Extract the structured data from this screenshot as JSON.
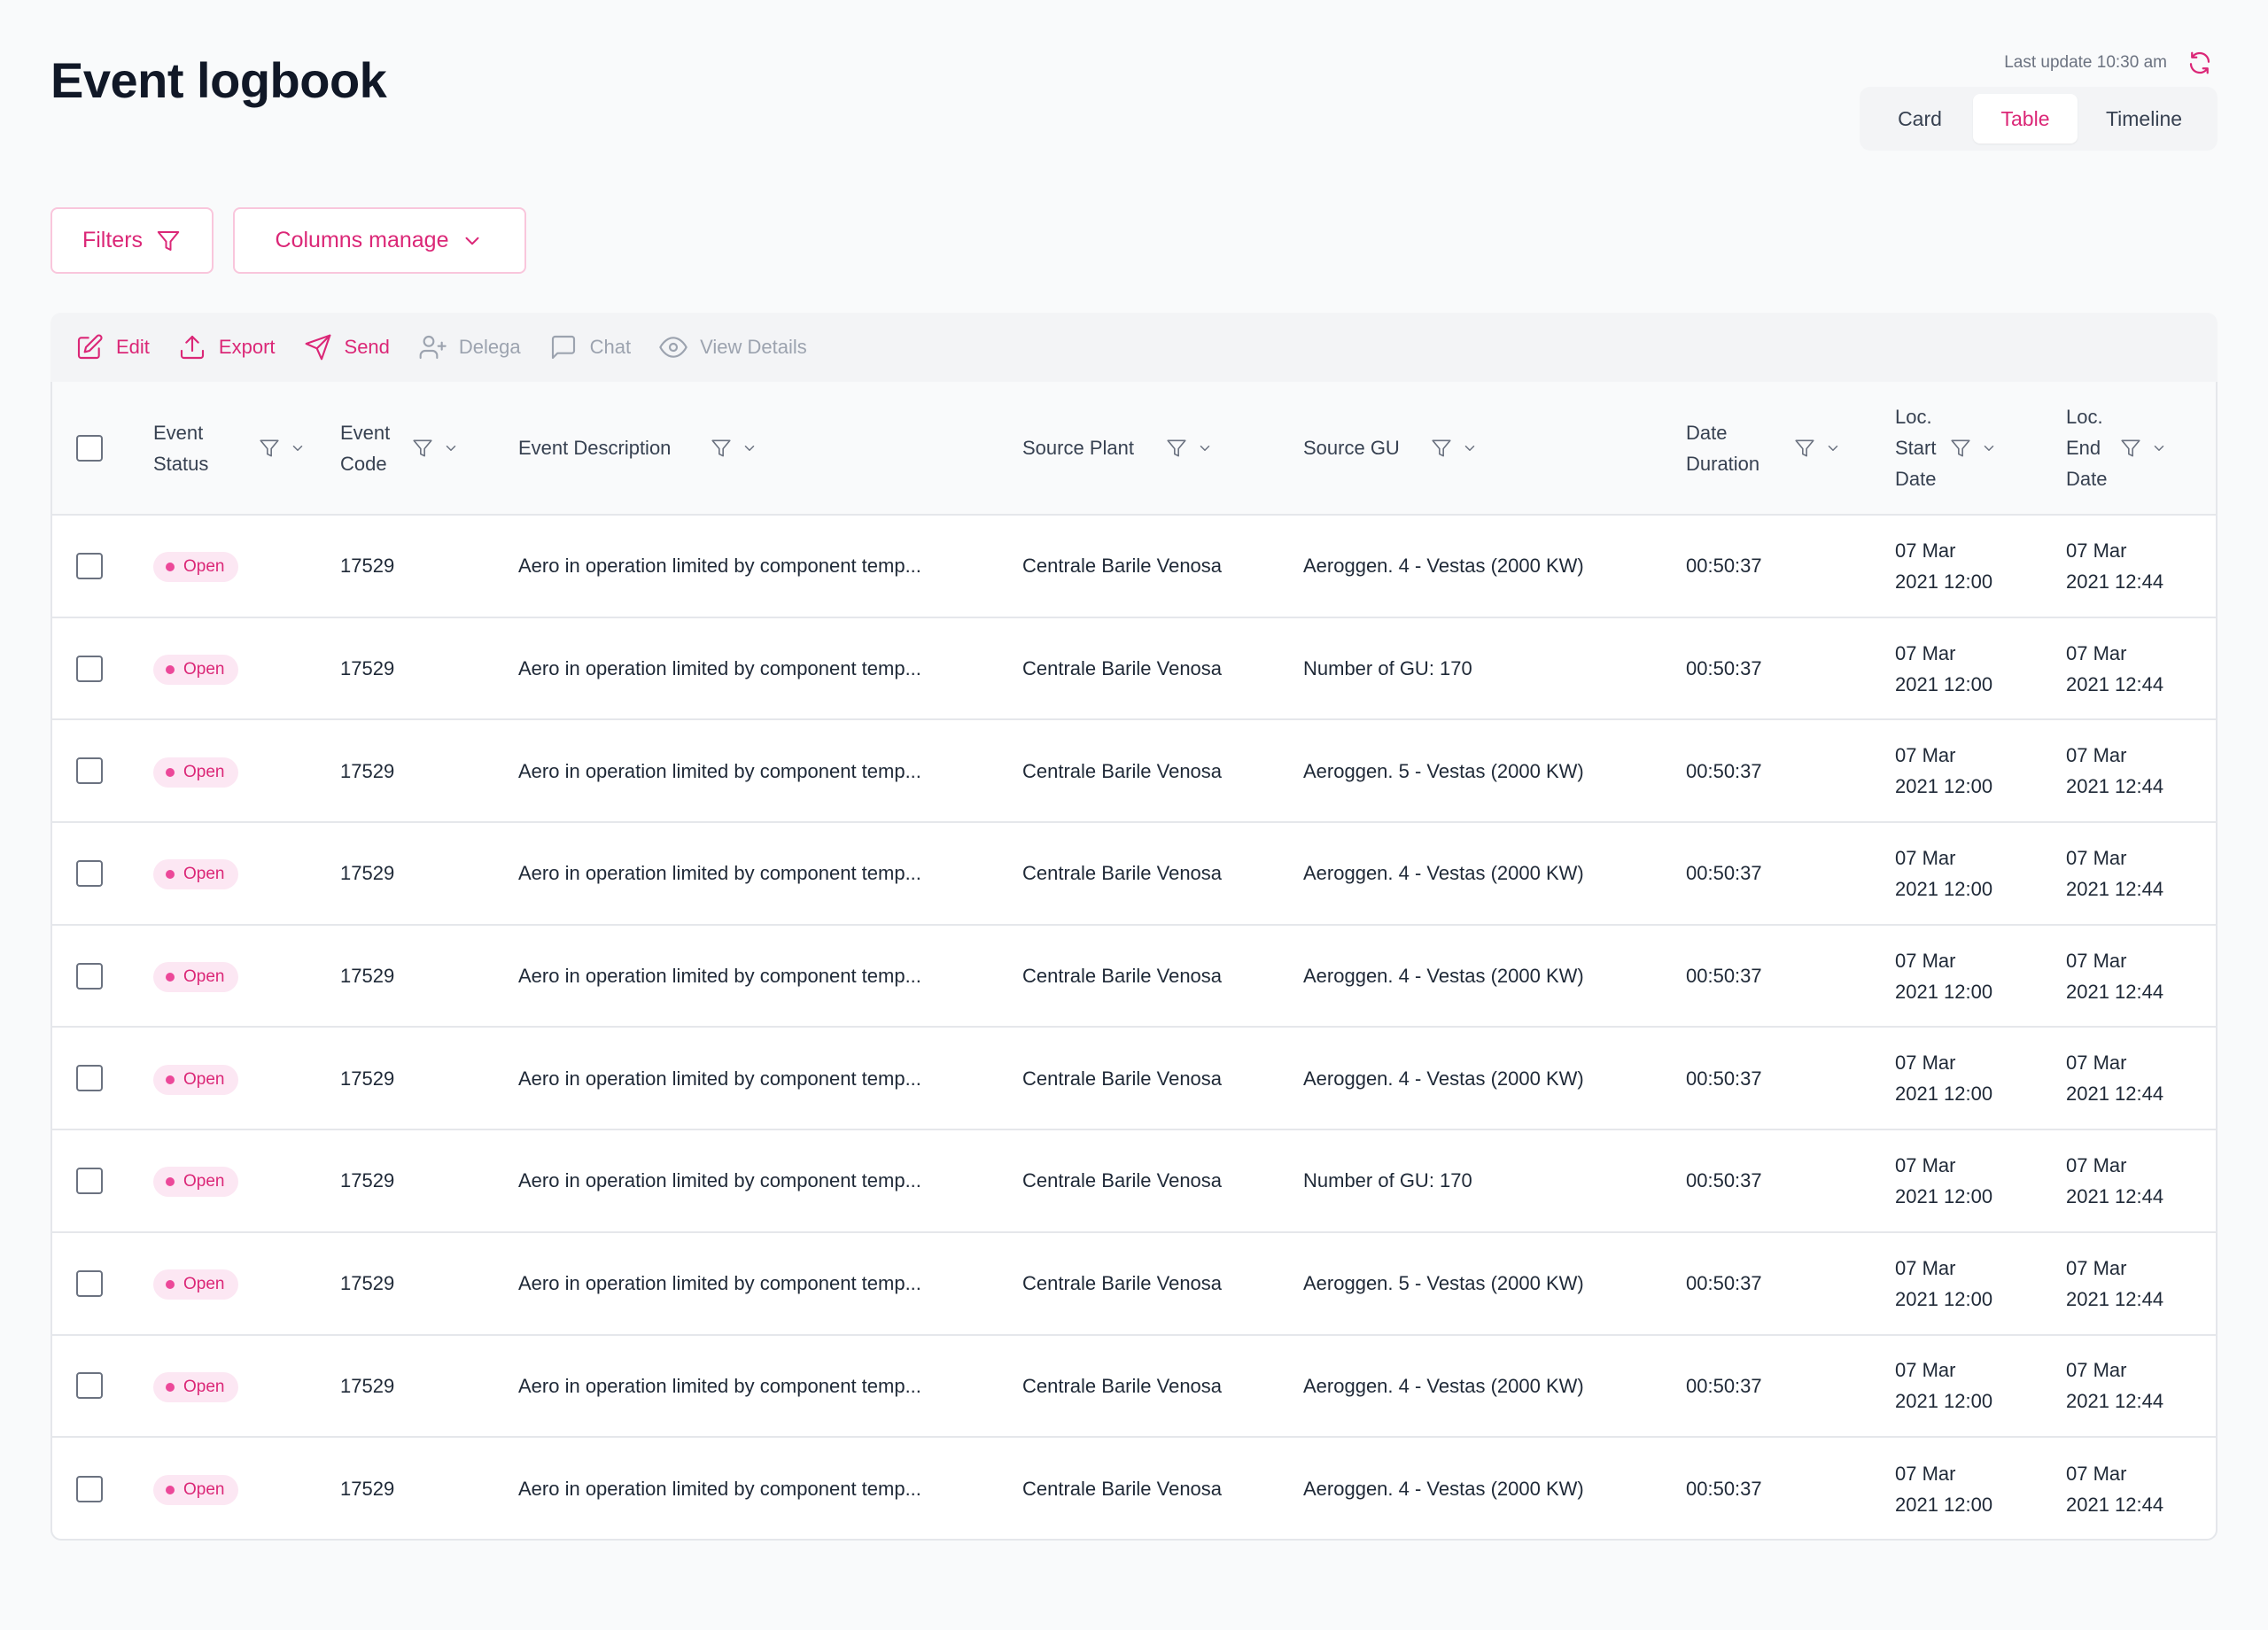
{
  "page": {
    "title": "Event logbook"
  },
  "header": {
    "last_update": "Last update 10:30 am",
    "views": [
      {
        "label": "Card",
        "active": false
      },
      {
        "label": "Table",
        "active": true
      },
      {
        "label": "Timeline",
        "active": false
      }
    ]
  },
  "controls": {
    "filters_label": "Filters",
    "columns_label": "Columns manage"
  },
  "toolbar": {
    "items": [
      {
        "label": "Edit",
        "icon": "edit-icon",
        "enabled": true
      },
      {
        "label": "Export",
        "icon": "upload-icon",
        "enabled": true
      },
      {
        "label": "Send",
        "icon": "send-icon",
        "enabled": true
      },
      {
        "label": "Delega",
        "icon": "user-plus-icon",
        "enabled": false
      },
      {
        "label": "Chat",
        "icon": "chat-icon",
        "enabled": false
      },
      {
        "label": "View Details",
        "icon": "eye-icon",
        "enabled": false
      }
    ]
  },
  "table": {
    "columns": [
      {
        "key": "status",
        "lines": [
          "Event",
          "Status"
        ]
      },
      {
        "key": "code",
        "lines": [
          "Event",
          "Code"
        ]
      },
      {
        "key": "description",
        "lines": [
          "Event Description"
        ]
      },
      {
        "key": "plant",
        "lines": [
          "Source Plant"
        ]
      },
      {
        "key": "gu",
        "lines": [
          "Source GU"
        ]
      },
      {
        "key": "duration",
        "lines": [
          "Date",
          "Duration"
        ]
      },
      {
        "key": "start",
        "lines": [
          "Loc.",
          "Start",
          "Date"
        ]
      },
      {
        "key": "end",
        "lines": [
          "Loc.",
          "End",
          "Date"
        ]
      }
    ],
    "rows": [
      {
        "status": "Open",
        "code": "17529",
        "description": "Aero in operation limited by component temp...",
        "plant": "Centrale Barile Venosa",
        "gu": "Aeroggen. 4 - Vestas (2000 KW)",
        "duration": "00:50:37",
        "start": [
          "07 Mar",
          "2021 12:00"
        ],
        "end": [
          "07 Mar",
          "2021 12:44"
        ]
      },
      {
        "status": "Open",
        "code": "17529",
        "description": "Aero in operation limited by component temp...",
        "plant": "Centrale Barile Venosa",
        "gu": "Number of GU: 170",
        "duration": "00:50:37",
        "start": [
          "07 Mar",
          "2021 12:00"
        ],
        "end": [
          "07 Mar",
          "2021 12:44"
        ]
      },
      {
        "status": "Open",
        "code": "17529",
        "description": "Aero in operation limited by component temp...",
        "plant": "Centrale Barile Venosa",
        "gu": "Aeroggen. 5 - Vestas (2000 KW)",
        "duration": "00:50:37",
        "start": [
          "07 Mar",
          "2021 12:00"
        ],
        "end": [
          "07 Mar",
          "2021 12:44"
        ]
      },
      {
        "status": "Open",
        "code": "17529",
        "description": "Aero in operation limited by component temp...",
        "plant": "Centrale Barile Venosa",
        "gu": "Aeroggen. 4 - Vestas (2000 KW)",
        "duration": "00:50:37",
        "start": [
          "07 Mar",
          "2021 12:00"
        ],
        "end": [
          "07 Mar",
          "2021 12:44"
        ]
      },
      {
        "status": "Open",
        "code": "17529",
        "description": "Aero in operation limited by component temp...",
        "plant": "Centrale Barile Venosa",
        "gu": "Aeroggen. 4 - Vestas (2000 KW)",
        "duration": "00:50:37",
        "start": [
          "07 Mar",
          "2021 12:00"
        ],
        "end": [
          "07 Mar",
          "2021 12:44"
        ]
      },
      {
        "status": "Open",
        "code": "17529",
        "description": "Aero in operation limited by component temp...",
        "plant": "Centrale Barile Venosa",
        "gu": "Aeroggen. 4 - Vestas (2000 KW)",
        "duration": "00:50:37",
        "start": [
          "07 Mar",
          "2021 12:00"
        ],
        "end": [
          "07 Mar",
          "2021 12:44"
        ]
      },
      {
        "status": "Open",
        "code": "17529",
        "description": "Aero in operation limited by component temp...",
        "plant": "Centrale Barile Venosa",
        "gu": "Number of GU: 170",
        "duration": "00:50:37",
        "start": [
          "07 Mar",
          "2021 12:00"
        ],
        "end": [
          "07 Mar",
          "2021 12:44"
        ]
      },
      {
        "status": "Open",
        "code": "17529",
        "description": "Aero in operation limited by component temp...",
        "plant": "Centrale Barile Venosa",
        "gu": "Aeroggen. 5 - Vestas (2000 KW)",
        "duration": "00:50:37",
        "start": [
          "07 Mar",
          "2021 12:00"
        ],
        "end": [
          "07 Mar",
          "2021 12:44"
        ]
      },
      {
        "status": "Open",
        "code": "17529",
        "description": "Aero in operation limited by component temp...",
        "plant": "Centrale Barile Venosa",
        "gu": "Aeroggen. 4 - Vestas (2000 KW)",
        "duration": "00:50:37",
        "start": [
          "07 Mar",
          "2021 12:00"
        ],
        "end": [
          "07 Mar",
          "2021 12:44"
        ]
      },
      {
        "status": "Open",
        "code": "17529",
        "description": "Aero in operation limited by component temp...",
        "plant": "Centrale Barile Venosa",
        "gu": "Aeroggen. 4 - Vestas (2000 KW)",
        "duration": "00:50:37",
        "start": [
          "07 Mar",
          "2021 12:00"
        ],
        "end": [
          "07 Mar",
          "2021 12:44"
        ]
      }
    ]
  },
  "colors": {
    "accent": "#db2777",
    "badge_bg": "#fce7f3",
    "border": "#e5e7eb",
    "muted": "#9ca3af"
  }
}
